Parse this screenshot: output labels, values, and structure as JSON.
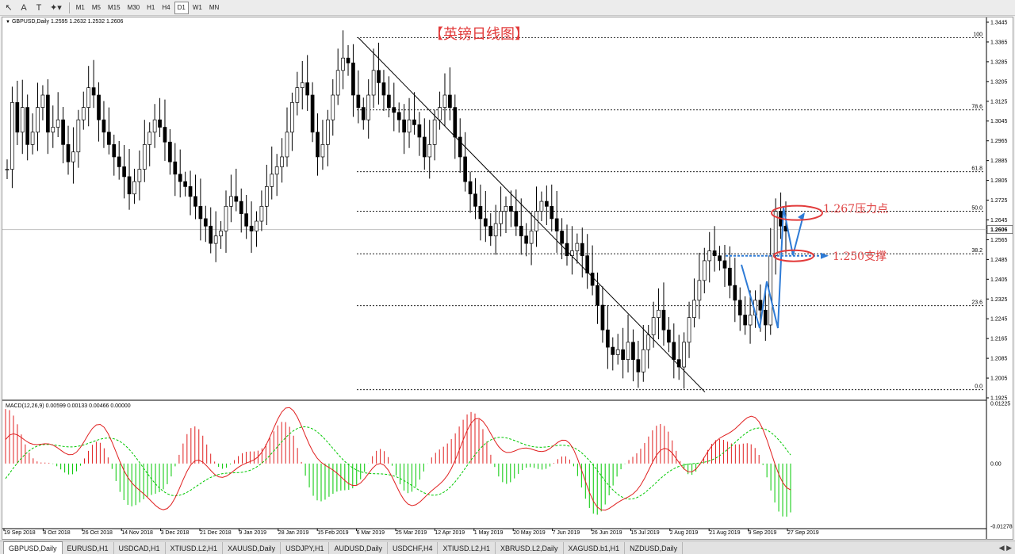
{
  "toolbar": {
    "tools": [
      {
        "name": "cursor-tool-icon",
        "glyph": "↖"
      },
      {
        "name": "text-tool-icon",
        "glyph": "A"
      },
      {
        "name": "text-label-tool-icon",
        "glyph": "T"
      },
      {
        "name": "shapes-menu-icon",
        "glyph": "✦▾"
      }
    ],
    "timeframes": [
      "M1",
      "M5",
      "M15",
      "M30",
      "H1",
      "H4",
      "D1",
      "W1",
      "MN"
    ],
    "active_timeframe": "D1"
  },
  "chart": {
    "symbol_header": "GBPUSD,Daily  1.2595 1.2632 1.2532 1.2606",
    "title": "【英镑日线图】",
    "annotations": {
      "resistance": "1.267压力点",
      "support": "1.250支撑"
    },
    "current_price": "1.2606",
    "macd_header": "MACD(12,26,9) 0.00599 0.00133 0.00466 0.00000",
    "fib_levels": [
      "100",
      "78.6",
      "61.8",
      "50.0",
      "38.2",
      "23.6",
      "0.0"
    ],
    "colors": {
      "annotation": "#e23b3b",
      "arrow": "#2e7bd6",
      "macd_line": "#e02020",
      "signal_line": "#00c800",
      "hist_pos": "#e02020",
      "hist_neg": "#00c800"
    }
  },
  "chart_data": {
    "type": "candlestick",
    "symbol": "GBPUSD",
    "timeframe": "Daily",
    "ohlc_latest": {
      "open": 1.2595,
      "high": 1.2632,
      "low": 1.2532,
      "close": 1.2606
    },
    "price_ticks": [
      "1.3445",
      "1.3365",
      "1.3285",
      "1.3205",
      "1.3125",
      "1.3045",
      "1.2965",
      "1.2885",
      "1.2805",
      "1.2725",
      "1.2645",
      "1.2565",
      "1.2485",
      "1.2405",
      "1.2325",
      "1.2245",
      "1.2165",
      "1.2085",
      "1.2005",
      "1.1925"
    ],
    "date_ticks": [
      "19 Sep 2018",
      "8 Oct 2018",
      "26 Oct 2018",
      "14 Nov 2018",
      "3 Dec 2018",
      "21 Dec 2018",
      "9 Jan 2019",
      "28 Jan 2019",
      "15 Feb 2019",
      "6 Mar 2019",
      "25 Mar 2019",
      "12 Apr 2019",
      "1 May 2019",
      "20 May 2019",
      "7 Jun 2019",
      "26 Jun 2019",
      "15 Jul 2019",
      "2 Aug 2019",
      "21 Aug 2019",
      "9 Sep 2019",
      "27 Sep 2019"
    ],
    "ylim": [
      1.1925,
      1.3445
    ],
    "fibonacci": [
      {
        "level": "100",
        "price": 1.3382
      },
      {
        "level": "78.6",
        "price": 1.309
      },
      {
        "level": "61.8",
        "price": 1.284
      },
      {
        "level": "50.0",
        "price": 1.268
      },
      {
        "level": "38.2",
        "price": 1.2508
      },
      {
        "level": "23.6",
        "price": 1.2298
      },
      {
        "level": "0.0",
        "price": 1.1958
      }
    ],
    "trendline": [
      {
        "date": "6 Mar 2019",
        "price": 1.3382
      },
      {
        "date": "3 Sep 2019",
        "price": 1.1958
      }
    ],
    "key_levels": [
      {
        "price": 1.267,
        "label": "1.267压力点"
      },
      {
        "price": 1.25,
        "label": "1.250支撑"
      }
    ],
    "close_series": [
      1.285,
      1.312,
      1.3,
      1.31,
      1.295,
      1.3,
      1.31,
      1.315,
      1.3,
      1.302,
      1.305,
      1.295,
      1.288,
      1.292,
      1.305,
      1.31,
      1.318,
      1.315,
      1.305,
      1.3,
      1.295,
      1.29,
      1.286,
      1.282,
      1.275,
      1.28,
      1.285,
      1.295,
      1.3,
      1.305,
      1.302,
      1.296,
      1.288,
      1.283,
      1.28,
      1.278,
      1.274,
      1.27,
      1.265,
      1.262,
      1.255,
      1.258,
      1.26,
      1.27,
      1.274,
      1.272,
      1.267,
      1.262,
      1.26,
      1.264,
      1.27,
      1.278,
      1.283,
      1.286,
      1.29,
      1.3,
      1.312,
      1.318,
      1.32,
      1.315,
      1.3,
      1.29,
      1.295,
      1.305,
      1.315,
      1.325,
      1.33,
      1.328,
      1.315,
      1.31,
      1.305,
      1.315,
      1.325,
      1.32,
      1.315,
      1.31,
      1.308,
      1.305,
      1.3,
      1.305,
      1.303,
      1.298,
      1.29,
      1.295,
      1.305,
      1.31,
      1.315,
      1.31,
      1.298,
      1.29,
      1.28,
      1.275,
      1.27,
      1.265,
      1.262,
      1.258,
      1.263,
      1.268,
      1.27,
      1.268,
      1.262,
      1.258,
      1.255,
      1.26,
      1.268,
      1.272,
      1.27,
      1.265,
      1.26,
      1.255,
      1.25,
      1.252,
      1.255,
      1.25,
      1.243,
      1.238,
      1.23,
      1.22,
      1.213,
      1.21,
      1.212,
      1.208,
      1.215,
      1.208,
      1.203,
      1.212,
      1.218,
      1.225,
      1.228,
      1.22,
      1.215,
      1.208,
      1.205,
      1.215,
      1.225,
      1.232,
      1.24,
      1.248,
      1.252,
      1.25,
      1.248,
      1.245,
      1.238,
      1.232,
      1.226,
      1.222,
      1.226,
      1.232,
      1.228,
      1.222,
      1.25,
      1.268,
      1.262,
      1.26
    ],
    "macd_ylim": [
      -0.01278,
      0.01225
    ],
    "macd_ticks": [
      "0.01225",
      "0.00",
      "-0.01278"
    ]
  },
  "tabs": {
    "items": [
      "GBPUSD,Daily",
      "EURUSD,H1",
      "USDCAD,H1",
      "XTIUSD.L2,H1",
      "XAUUSD,Daily",
      "USDJPY,H1",
      "AUDUSD,Daily",
      "USDCHF,H4",
      "XTIUSD.L2,H1",
      "XBRUSD.L2,Daily",
      "XAGUSD.b1,H1",
      "NZDUSD,Daily"
    ],
    "active": "GBPUSD,Daily"
  }
}
